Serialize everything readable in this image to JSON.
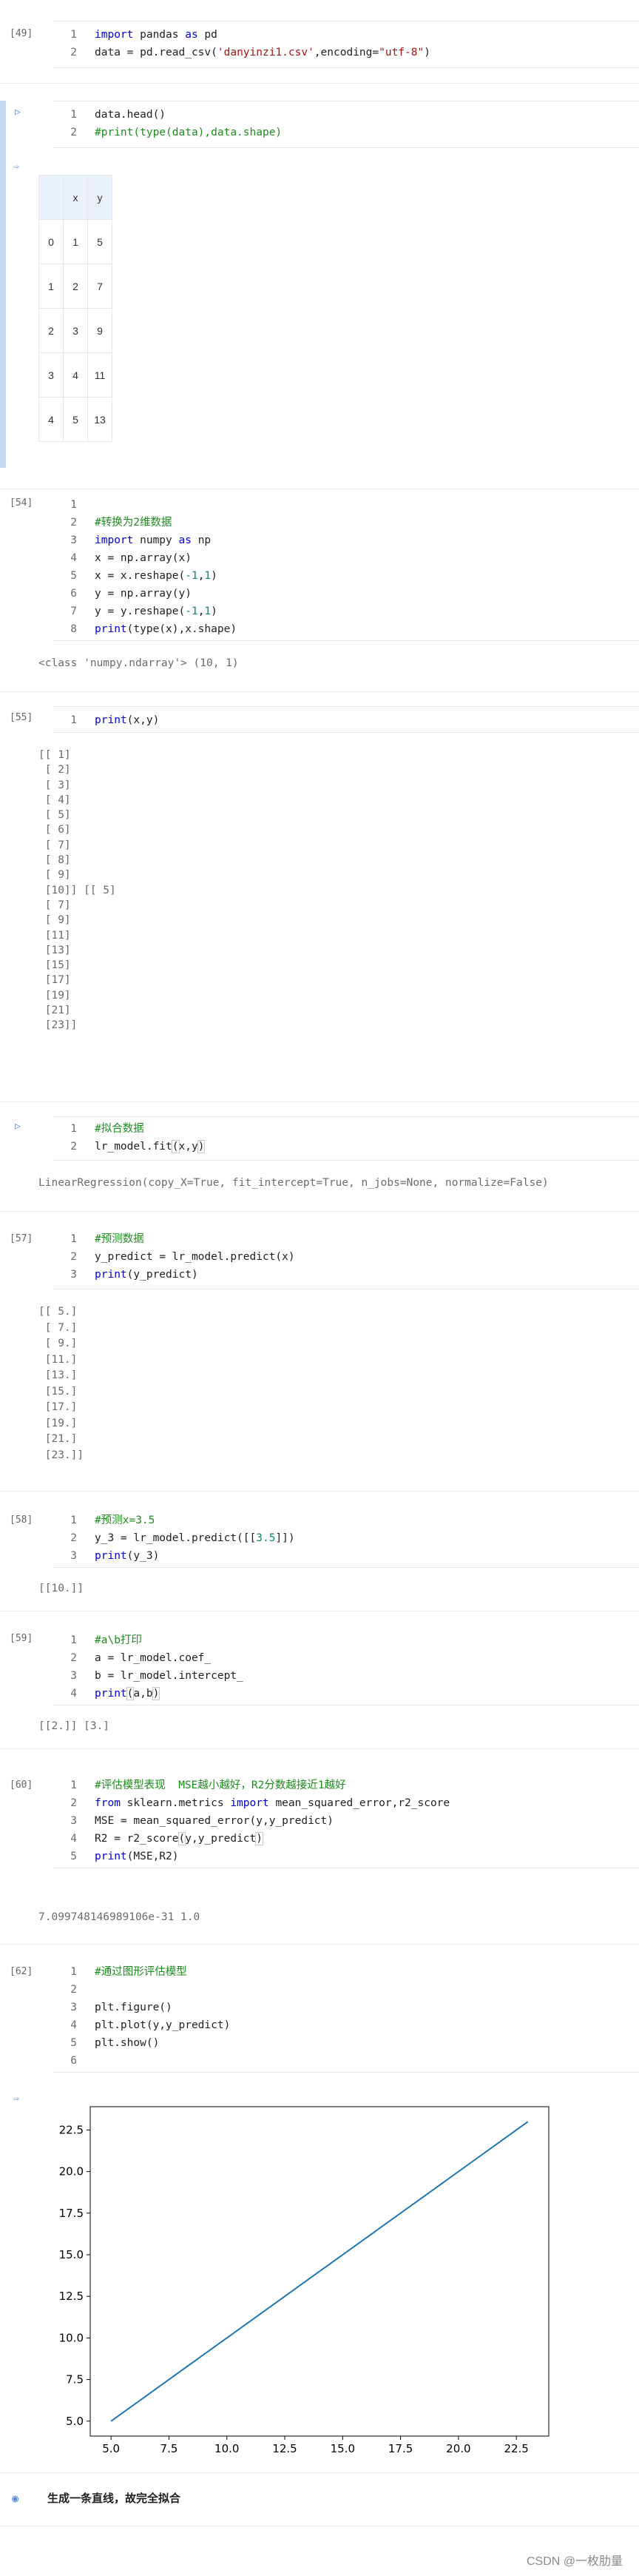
{
  "cells": [
    {
      "exec": "[49]",
      "lines": [
        {
          "n": "1",
          "html": "<span class='kw'>import</span> pandas <span class='kw'>as</span> pd"
        },
        {
          "n": "2",
          "html": "data = pd.read_csv(<span class='str'>'danyinzi1.csv'</span>,encoding=<span class='str'>\"utf-8\"</span>)"
        }
      ]
    },
    {
      "exec": "▷",
      "lines": [
        {
          "n": "1",
          "html": "data.head()"
        },
        {
          "n": "2",
          "html": "<span class='cm'>#print(type(data),data.shape)</span>"
        }
      ]
    },
    {
      "exec": "[54]",
      "lines": [
        {
          "n": "1",
          "html": ""
        },
        {
          "n": "2",
          "html": "<span class='cm'>#转换为2维数据</span>"
        },
        {
          "n": "3",
          "html": "<span class='kw'>import</span> numpy <span class='kw'>as</span> np"
        },
        {
          "n": "4",
          "html": "x = np.array(x)"
        },
        {
          "n": "5",
          "html": "x = x.reshape(<span class='num'>-1</span>,<span class='num'>1</span>)"
        },
        {
          "n": "6",
          "html": "y = np.array(y)"
        },
        {
          "n": "7",
          "html": "y = y.reshape(<span class='num'>-1</span>,<span class='num'>1</span>)"
        },
        {
          "n": "8",
          "html": "<span class='kw'>print</span>(type(x),x.shape)"
        }
      ]
    },
    {
      "exec": "[55]",
      "lines": [
        {
          "n": "1",
          "html": "<span class='kw'>print</span>(x,y)"
        }
      ]
    },
    {
      "exec": "▷",
      "lines": [
        {
          "n": "1",
          "html": "<span class='cm'>#拟合数据</span>"
        },
        {
          "n": "2",
          "html": "lr_model.fit<span class='bracket-hl'>(</span>x,y<span class='bracket-hl'>)</span>"
        }
      ]
    },
    {
      "exec": "[57]",
      "lines": [
        {
          "n": "1",
          "html": "<span class='cm'>#预测数据</span>"
        },
        {
          "n": "2",
          "html": "y_predict = lr_model.predict(x)"
        },
        {
          "n": "3",
          "html": "<span class='kw'>print</span>(y_predict)"
        }
      ]
    },
    {
      "exec": "[58]",
      "lines": [
        {
          "n": "1",
          "html": "<span class='cm'>#预测x=3.5</span>"
        },
        {
          "n": "2",
          "html": "y_3 = lr_model.predict([[<span class='num'>3.5</span>]])"
        },
        {
          "n": "3",
          "html": "<span class='kw'>print</span>(y_3)"
        }
      ]
    },
    {
      "exec": "[59]",
      "lines": [
        {
          "n": "1",
          "html": "<span class='cm'>#a\\b打印</span>"
        },
        {
          "n": "2",
          "html": "a = lr_model.coef_"
        },
        {
          "n": "3",
          "html": "b = lr_model.intercept_"
        },
        {
          "n": "4",
          "html": "<span class='kw'>print</span><span class='bracket-hl'>(</span>a,b<span class='bracket-hl'>)</span>"
        }
      ]
    },
    {
      "exec": "[60]",
      "lines": [
        {
          "n": "1",
          "html": "<span class='cm'>#评估模型表现  MSE越小越好，R2分数越接近1越好</span>"
        },
        {
          "n": "2",
          "html": "<span class='kw'>from</span> sklearn.metrics <span class='kw'>import</span> mean_squared_error,r2_score"
        },
        {
          "n": "3",
          "html": "MSE = mean_squared_error(y,y_predict)"
        },
        {
          "n": "4",
          "html": "R2 = r2_score<span class='bracket-hl'>(</span>y,y_predict<span class='bracket-hl'>)</span>"
        },
        {
          "n": "5",
          "html": "<span class='kw'>print</span>(MSE,R2)"
        }
      ]
    },
    {
      "exec": "[62]",
      "lines": [
        {
          "n": "1",
          "html": "<span class='cm'>#通过图形评估模型</span>"
        },
        {
          "n": "2",
          "html": ""
        },
        {
          "n": "3",
          "html": "plt.figure()"
        },
        {
          "n": "4",
          "html": "plt.plot(y,y_predict)"
        },
        {
          "n": "5",
          "html": "plt.show()"
        },
        {
          "n": "6",
          "html": ""
        }
      ]
    }
  ],
  "dataframe": {
    "columns": [
      "",
      "x",
      "y"
    ],
    "rows": [
      [
        "0",
        "1",
        "5"
      ],
      [
        "1",
        "2",
        "7"
      ],
      [
        "2",
        "3",
        "9"
      ],
      [
        "3",
        "4",
        "11"
      ],
      [
        "4",
        "5",
        "13"
      ]
    ]
  },
  "outputs": {
    "shape": "<class 'numpy.ndarray'> (10, 1)",
    "xy": "[[ 1]\n [ 2]\n [ 3]\n [ 4]\n [ 5]\n [ 6]\n [ 7]\n [ 8]\n [ 9]\n [10]] [[ 5]\n [ 7]\n [ 9]\n [11]\n [13]\n [15]\n [17]\n [19]\n [21]\n [23]]",
    "fit": "LinearRegression(copy_X=True, fit_intercept=True, n_jobs=None, normalize=False)",
    "predict": "[[ 5.]\n [ 7.]\n [ 9.]\n [11.]\n [13.]\n [15.]\n [17.]\n [19.]\n [21.]\n [23.]]",
    "y3": "[[10.]]",
    "ab": "[[2.]] [3.]",
    "mse": "7.099748146989106e-31 1.0"
  },
  "markdown": {
    "text": "生成一条直线，故完全拟合"
  },
  "watermark": "CSDN @一枚肋量",
  "colors": {
    "line": "#1f77b4",
    "active_bar": "#c2d9f4",
    "keyword": "#0000d6",
    "string": "#a31515",
    "comment": "#1d8c1d"
  },
  "icons": {
    "run": "play-triangle-icon",
    "output": "output-arrow-icon",
    "markdown": "eye-icon"
  },
  "chart_data": {
    "type": "line",
    "x": [
      5,
      7,
      9,
      11,
      13,
      15,
      17,
      19,
      21,
      23
    ],
    "y": [
      5,
      7,
      9,
      11,
      13,
      15,
      17,
      19,
      21,
      23
    ],
    "xticks": [
      "5.0",
      "7.5",
      "10.0",
      "12.5",
      "15.0",
      "17.5",
      "20.0",
      "22.5"
    ],
    "yticks": [
      "5.0",
      "7.5",
      "10.0",
      "12.5",
      "15.0",
      "17.5",
      "20.0",
      "22.5"
    ],
    "xlim": [
      4.1,
      23.9
    ],
    "ylim": [
      4.1,
      23.9
    ],
    "grid": false,
    "title": "",
    "xlabel": "",
    "ylabel": ""
  }
}
